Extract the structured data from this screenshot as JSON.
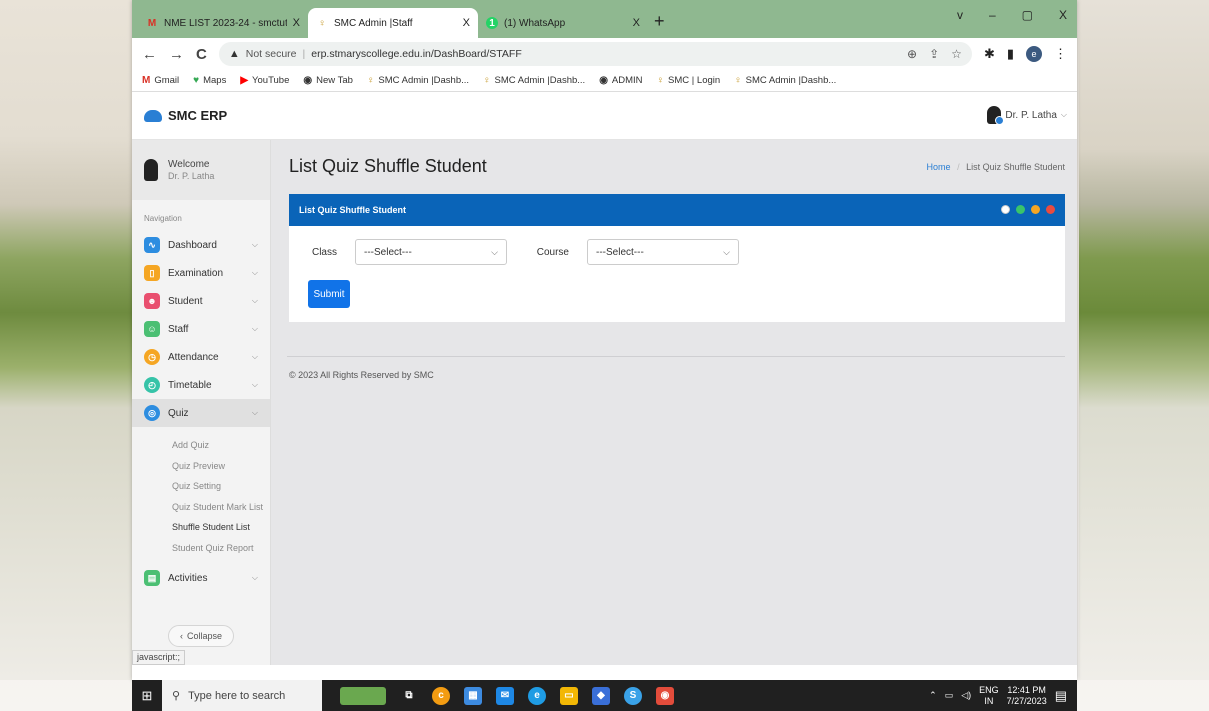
{
  "browser": {
    "tabs": [
      {
        "icon": "gmail-icon",
        "label": "NME LIST 2023-24 - smctut.erp2(",
        "close": "X",
        "active": false
      },
      {
        "icon": "smc-logo-icon",
        "label": "SMC Admin |Staff",
        "close": "X",
        "active": true
      },
      {
        "icon": "whatsapp-icon",
        "label": "(1) WhatsApp",
        "close": "X",
        "active": false
      }
    ],
    "new_tab": "+",
    "window_controls": [
      "v",
      "–",
      "▢",
      "X"
    ],
    "address": {
      "security": "Not secure",
      "url": "erp.stmaryscollege.edu.in/DashBoard/STAFF"
    },
    "bookmarks": [
      "Gmail",
      "Maps",
      "YouTube",
      "New Tab",
      "SMC Admin |Dashb...",
      "SMC Admin |Dashb...",
      "ADMIN",
      "SMC | Login",
      "SMC Admin |Dashb..."
    ],
    "status_link": "javascript:;"
  },
  "app": {
    "brand": "SMC ERP",
    "user": "Dr. P. Latha",
    "welcome": {
      "title": "Welcome",
      "name": "Dr. P. Latha"
    },
    "nav_heading": "Navigation",
    "nav": [
      {
        "label": "Dashboard",
        "icon": "dashboard-icon",
        "color": "#2d8de0"
      },
      {
        "label": "Examination",
        "icon": "book-icon",
        "color": "#f5a623"
      },
      {
        "label": "Student",
        "icon": "student-icon",
        "color": "#e94f6f"
      },
      {
        "label": "Staff",
        "icon": "staff-icon",
        "color": "#4bbf73"
      },
      {
        "label": "Attendance",
        "icon": "clock-icon",
        "color": "#f5a623"
      },
      {
        "label": "Timetable",
        "icon": "timetable-icon",
        "color": "#36c3a8"
      },
      {
        "label": "Quiz",
        "icon": "quiz-icon",
        "color": "#2d8de0"
      }
    ],
    "quiz_sub": [
      "Add Quiz",
      "Quiz Preview",
      "Quiz Setting",
      "Quiz Student Mark List",
      "Shuffle Student List",
      "Student Quiz Report"
    ],
    "activities": {
      "label": "Activities",
      "icon": "activities-icon",
      "color": "#4bbf73"
    },
    "collapse": "Collapse",
    "page_title": "List Quiz Shuffle Student",
    "breadcrumb": {
      "home": "Home",
      "sep": "/",
      "current": "List Quiz Shuffle Student"
    },
    "card_title": "List Quiz Shuffle Student",
    "card_tools": [
      {
        "icon": "check-icon",
        "color": "#ffffff"
      },
      {
        "icon": "refresh-icon",
        "color": "#39c46a"
      },
      {
        "icon": "minimize-icon",
        "color": "#f5a623"
      },
      {
        "icon": "close-icon",
        "color": "#ea4b3f"
      }
    ],
    "form": {
      "class_label": "Class",
      "class_value": "---Select---",
      "course_label": "Course",
      "course_value": "---Select---",
      "submit": "Submit"
    },
    "footer": "© 2023 All Rights Reserved by SMC"
  },
  "taskbar": {
    "search_placeholder": "Type here to search",
    "time": "12:41 PM",
    "date": "7/27/2023",
    "lang": "ENG",
    "region": "IN"
  }
}
